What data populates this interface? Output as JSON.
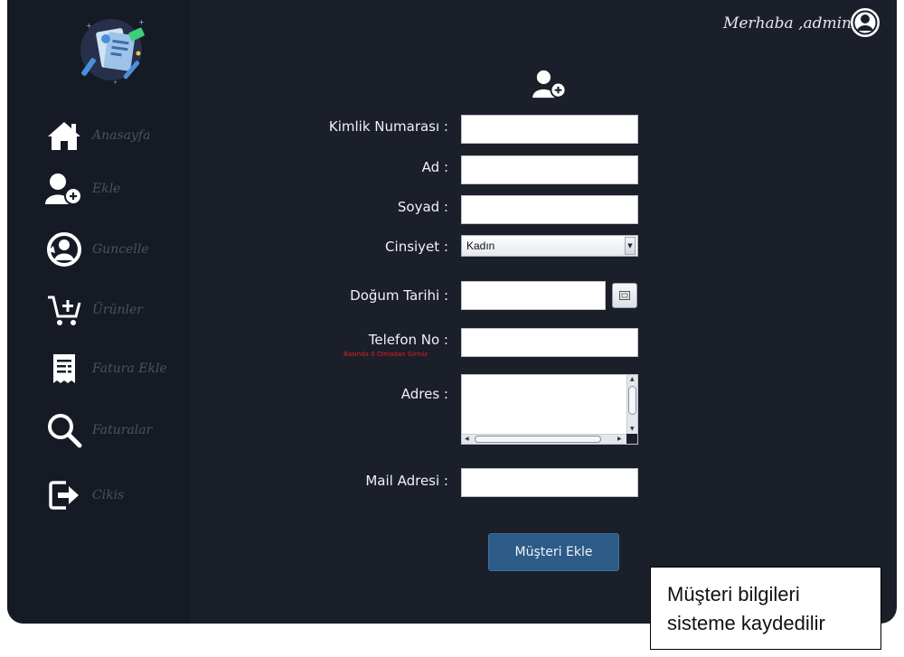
{
  "header": {
    "greeting": "Merhaba ,admin"
  },
  "sidebar": {
    "items": [
      {
        "label": "Anasayfa",
        "icon": "home-icon"
      },
      {
        "label": "Ekle",
        "icon": "user-add-icon"
      },
      {
        "label": "Guncelle",
        "icon": "user-refresh-icon"
      },
      {
        "label": "Ürünler",
        "icon": "cart-add-icon"
      },
      {
        "label": "Fatura Ekle",
        "icon": "invoice-icon"
      },
      {
        "label": "Faturalar",
        "icon": "search-icon"
      },
      {
        "label": "Cikis",
        "icon": "exit-icon"
      }
    ]
  },
  "form": {
    "id_label": "Kimlik Numarası :",
    "id_value": "",
    "name_label": "Ad :",
    "name_value": "",
    "surname_label": "Soyad :",
    "surname_value": "",
    "gender_label": "Cinsiyet :",
    "gender_value": "Kadın",
    "birth_label": "Doğum Tarihi :",
    "phone_label": "Telefon No :",
    "phone_hint": "Basında 0 Olmadan Giriniz",
    "phone_value": "",
    "address_label": "Adres :",
    "address_value": "",
    "mail_label": "Mail Adresi :",
    "mail_value": "",
    "submit_label": "Müşteri Ekle"
  },
  "annotation": {
    "line1": "Müşteri bilgileri",
    "line2": "sisteme kaydedilir"
  },
  "colors": {
    "app_background": "#1b1f2a",
    "sidebar_background": "#161a24",
    "button": "#2d5b87",
    "hint_text": "#e02020"
  }
}
